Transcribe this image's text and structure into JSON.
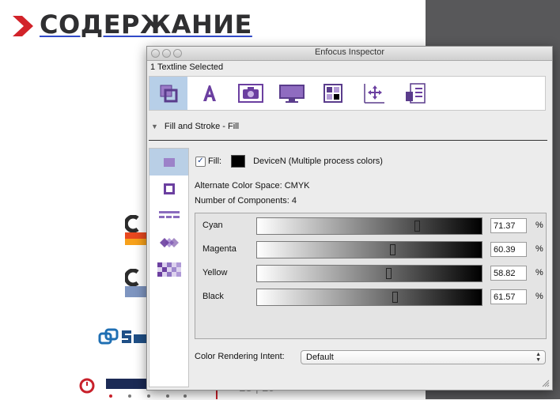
{
  "slide": {
    "title": "СОДЕРЖАНИЕ",
    "page_number": "18 | 19",
    "colors": {
      "dark_panel": "#58585a",
      "accent_red": "#d2232a",
      "underline": "#3049c8"
    }
  },
  "inspector": {
    "window_title": "Enfocus Inspector",
    "selection_info": "1 Textline Selected",
    "toolbar": [
      {
        "icon": "fill-stroke-icon",
        "active": true
      },
      {
        "icon": "text-icon",
        "glyph": "A"
      },
      {
        "icon": "image-icon"
      },
      {
        "icon": "monitor-icon"
      },
      {
        "icon": "grid-icon"
      },
      {
        "icon": "position-icon"
      },
      {
        "icon": "document-list-icon"
      }
    ],
    "section_title": "Fill and Stroke - Fill",
    "side_tabs": [
      "fill-icon",
      "stroke-icon",
      "dash-icon",
      "overprint-icon",
      "transparency-icon"
    ],
    "fill": {
      "label": "Fill:",
      "checked": true,
      "color_name": "DeviceN (Multiple process colors)",
      "swatch_color": "#000000"
    },
    "alternate_color_space": "Alternate Color Space: CMYK",
    "number_of_components": "Number of Components: 4",
    "components": [
      {
        "name": "Cyan",
        "value": "71.37",
        "unit": "%"
      },
      {
        "name": "Magenta",
        "value": "60.39",
        "unit": "%"
      },
      {
        "name": "Yellow",
        "value": "58.82",
        "unit": "%"
      },
      {
        "name": "Black",
        "value": "61.57",
        "unit": "%"
      }
    ],
    "color_rendering_intent": {
      "label": "Color Rendering Intent:",
      "value": "Default"
    },
    "colors": {
      "accent_purple": "#6b3fa0",
      "selected_tab": "#b7cfe8"
    }
  }
}
